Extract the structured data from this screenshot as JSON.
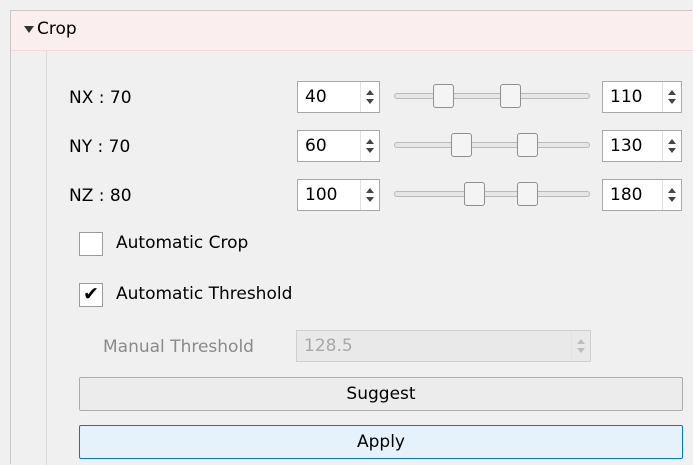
{
  "section": {
    "title": "Crop",
    "expanded": true
  },
  "ranges": [
    {
      "label": "NX : 70",
      "min_value": "40",
      "max_value": "110",
      "low_fraction": 0.25,
      "high_fraction": 0.59
    },
    {
      "label": "NY : 70",
      "min_value": "60",
      "max_value": "130",
      "low_fraction": 0.34,
      "high_fraction": 0.68
    },
    {
      "label": "NZ : 80",
      "min_value": "100",
      "max_value": "180",
      "low_fraction": 0.41,
      "high_fraction": 0.68
    }
  ],
  "automatic_crop": {
    "label": "Automatic Crop",
    "checked": false
  },
  "automatic_threshold": {
    "label": "Automatic Threshold",
    "checked": true,
    "check_glyph": "✔"
  },
  "manual_threshold": {
    "label": "Manual Threshold",
    "value": "128.5",
    "disabled": true
  },
  "buttons": {
    "suggest": "Suggest",
    "apply": "Apply"
  },
  "colors": {
    "header_bg": "#fbeeee",
    "apply_border": "#0078d7",
    "apply_bg": "#e5f1fb"
  }
}
